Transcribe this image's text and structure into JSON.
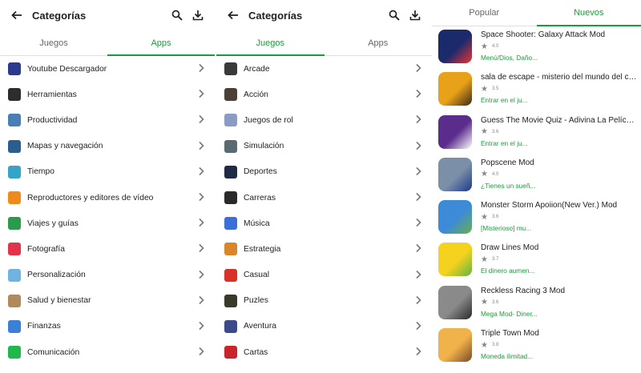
{
  "colors": {
    "accent": "#1a9c3a"
  },
  "panel_left": {
    "title": "Categorías",
    "tabs": [
      {
        "label": "Juegos"
      },
      {
        "label": "Apps"
      }
    ],
    "active_tab": 1,
    "items": [
      {
        "label": "Youtube Descargador",
        "icon": "youtube-downloader-icon",
        "color": "#2b3a8c"
      },
      {
        "label": "Herramientas",
        "icon": "tools-icon",
        "color": "#2d2d2d"
      },
      {
        "label": "Productividad",
        "icon": "productivity-icon",
        "color": "#4a7fb5"
      },
      {
        "label": "Mapas y navegación",
        "icon": "maps-icon",
        "color": "#2c5d8f"
      },
      {
        "label": "Tiempo",
        "icon": "weather-icon",
        "color": "#36a4c9"
      },
      {
        "label": "Reproductores y editores de vídeo",
        "icon": "vlc-icon",
        "color": "#f08a1c"
      },
      {
        "label": "Viajes y guías",
        "icon": "travel-icon",
        "color": "#2b9a4a"
      },
      {
        "label": "Fotografía",
        "icon": "photo-icon",
        "color": "#e2334d"
      },
      {
        "label": "Personalización",
        "icon": "personalization-icon",
        "color": "#6fb3e0"
      },
      {
        "label": "Salud y bienestar",
        "icon": "health-icon",
        "color": "#b08a5a"
      },
      {
        "label": "Finanzas",
        "icon": "finance-icon",
        "color": "#3c7fd6"
      },
      {
        "label": "Comunicación",
        "icon": "line-icon",
        "color": "#1fb84c"
      }
    ]
  },
  "panel_mid": {
    "title": "Categorías",
    "tabs": [
      {
        "label": "Juegos"
      },
      {
        "label": "Apps"
      }
    ],
    "active_tab": 0,
    "items": [
      {
        "label": "Arcade",
        "icon": "arcade-icon",
        "color": "#3a3a3a"
      },
      {
        "label": "Acción",
        "icon": "action-icon",
        "color": "#4c4036"
      },
      {
        "label": "Juegos de rol",
        "icon": "rpg-icon",
        "color": "#8a9cc4"
      },
      {
        "label": "Simulación",
        "icon": "simulation-icon",
        "color": "#5a6a72"
      },
      {
        "label": "Deportes",
        "icon": "sports-icon",
        "color": "#1f2b44"
      },
      {
        "label": "Carreras",
        "icon": "racing-icon",
        "color": "#2a2a2a"
      },
      {
        "label": "Música",
        "icon": "music-icon",
        "color": "#3b6fd8"
      },
      {
        "label": "Estrategia",
        "icon": "strategy-icon",
        "color": "#d9862a"
      },
      {
        "label": "Casual",
        "icon": "casual-icon",
        "color": "#d8312a"
      },
      {
        "label": "Puzles",
        "icon": "puzzle-icon",
        "color": "#3a3a2a"
      },
      {
        "label": "Aventura",
        "icon": "adventure-icon",
        "color": "#3a4a8a"
      },
      {
        "label": "Cartas",
        "icon": "cards-icon",
        "color": "#c8242a"
      }
    ]
  },
  "panel_right": {
    "tabs": [
      {
        "label": "Popular"
      },
      {
        "label": "Nuevos"
      }
    ],
    "active_tab": 1,
    "apps": [
      {
        "name": "Space Shooter: Galaxy Attack Mod",
        "rating": "4.0",
        "mod": "Menú/Dios, Daño...",
        "color": "#1b2a6b",
        "accent": "#e33"
      },
      {
        "name": "sala de escape - misterio del mundo del cír...",
        "rating": "3.5",
        "mod": "Entrar en el ju...",
        "color": "#e8a21a",
        "accent": "#3a2a1a"
      },
      {
        "name": "Guess The Movie Quiz - Adivina La Película ...",
        "rating": "3.6",
        "mod": "Entrar en el ju...",
        "color": "#5a2d8c",
        "accent": "#fff"
      },
      {
        "name": "Popscene Mod",
        "rating": "4.0",
        "mod": "¿Tienes un sueñ...",
        "color": "#7c8fa8",
        "accent": "#1a3a8a"
      },
      {
        "name": "Monster Storm Apoiion(New Ver.) Mod",
        "rating": "3.6",
        "mod": "[Misterioso] mu...",
        "color": "#3d8bd6",
        "accent": "#6ab04c"
      },
      {
        "name": "Draw Lines Mod",
        "rating": "3.7",
        "mod": "El dinero aumen...",
        "color": "#f4d21e",
        "accent": "#5fb646"
      },
      {
        "name": "Reckless Racing 3 Mod",
        "rating": "3.6",
        "mod": "Mega Mod- Diner...",
        "color": "#8a8a8a",
        "accent": "#2a2a2a"
      },
      {
        "name": "Triple Town Mod",
        "rating": "3.8",
        "mod": "Moneda ilimitad...",
        "color": "#f0b24a",
        "accent": "#7a4a2a"
      }
    ]
  }
}
